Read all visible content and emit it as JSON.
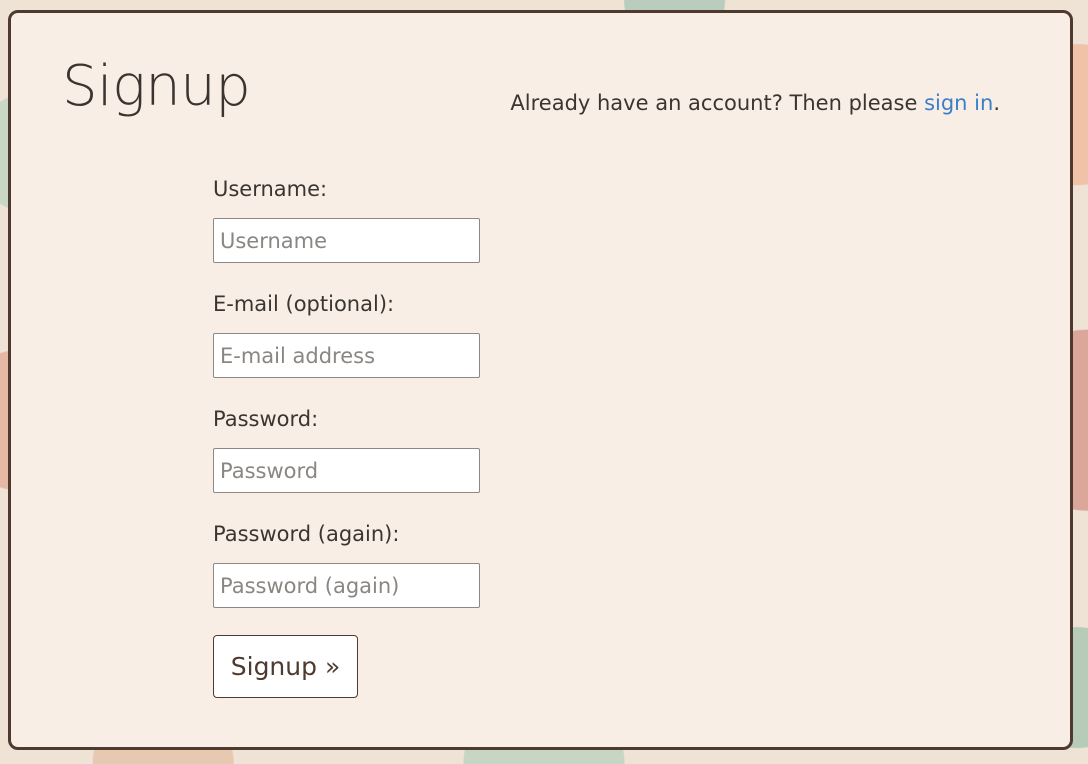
{
  "page": {
    "title": "Signup",
    "signin_prefix": "Already have an account? Then please ",
    "signin_link": "sign in",
    "signin_suffix": "."
  },
  "form": {
    "username": {
      "label": "Username:",
      "placeholder": "Username",
      "value": ""
    },
    "email": {
      "label": "E-mail (optional):",
      "placeholder": "E-mail address",
      "value": ""
    },
    "password": {
      "label": "Password:",
      "placeholder": "Password",
      "value": ""
    },
    "password_again": {
      "label": "Password (again):",
      "placeholder": "Password (again)",
      "value": ""
    },
    "submit_label": "Signup »"
  },
  "colors": {
    "card_background": "#f8eee5",
    "card_border": "#4f3a30",
    "link": "#3a7fc9",
    "text": "#3b3532"
  }
}
